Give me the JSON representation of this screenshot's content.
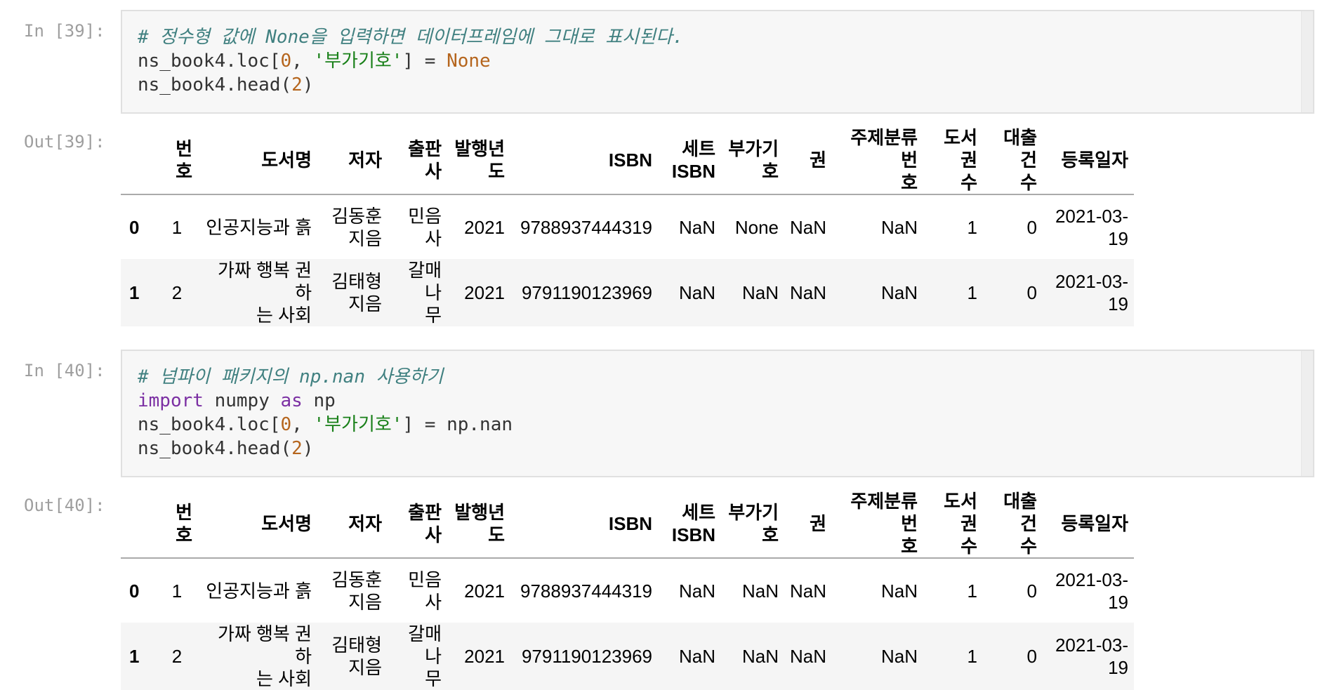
{
  "cells": [
    {
      "in_prompt": "In [39]:",
      "code_lines": [
        [
          {
            "t": "cm",
            "v": "# 정수형 값에 None을 입력하면 데이터프레임에 그대로 표시된다."
          }
        ],
        [
          {
            "t": "",
            "v": "ns_book4.loc["
          },
          {
            "t": "num",
            "v": "0"
          },
          {
            "t": "",
            "v": ", "
          },
          {
            "t": "str",
            "v": "'부가기호'"
          },
          {
            "t": "",
            "v": "] = "
          },
          {
            "t": "nn",
            "v": "None"
          }
        ],
        [
          {
            "t": "",
            "v": "ns_book4.head("
          },
          {
            "t": "num",
            "v": "2"
          },
          {
            "t": "",
            "v": ")"
          }
        ]
      ],
      "out_prompt": "Out[39]:",
      "table": {
        "headers": [
          [
            "",
            ""
          ],
          [
            "번",
            "호"
          ],
          [
            "도서명",
            ""
          ],
          [
            "저자",
            ""
          ],
          [
            "출판사",
            ""
          ],
          [
            "발행년",
            "도"
          ],
          [
            "ISBN",
            ""
          ],
          [
            "세트",
            "ISBN"
          ],
          [
            "부가기",
            "호"
          ],
          [
            "권",
            ""
          ],
          [
            "주제분류번",
            "호"
          ],
          [
            "도서권",
            "수"
          ],
          [
            "대출건",
            "수"
          ],
          [
            "등록일자",
            ""
          ]
        ],
        "rows": [
          [
            [
              "0",
              ""
            ],
            [
              "1",
              ""
            ],
            [
              "인공지능과 흙",
              ""
            ],
            [
              "김동훈",
              "지음"
            ],
            [
              "민음사",
              ""
            ],
            [
              "2021",
              ""
            ],
            [
              "9788937444319",
              ""
            ],
            [
              "NaN",
              ""
            ],
            [
              "None",
              ""
            ],
            [
              "NaN",
              ""
            ],
            [
              "NaN",
              ""
            ],
            [
              "1",
              ""
            ],
            [
              "0",
              ""
            ],
            [
              "2021-03-",
              "19"
            ]
          ],
          [
            [
              "1",
              ""
            ],
            [
              "2",
              ""
            ],
            [
              "가짜 행복 권하",
              "는 사회"
            ],
            [
              "김태형",
              "지음"
            ],
            [
              "갈매나",
              "무"
            ],
            [
              "2021",
              ""
            ],
            [
              "9791190123969",
              ""
            ],
            [
              "NaN",
              ""
            ],
            [
              "NaN",
              ""
            ],
            [
              "NaN",
              ""
            ],
            [
              "NaN",
              ""
            ],
            [
              "1",
              ""
            ],
            [
              "0",
              ""
            ],
            [
              "2021-03-",
              "19"
            ]
          ]
        ]
      }
    },
    {
      "in_prompt": "In [40]:",
      "code_lines": [
        [
          {
            "t": "cm",
            "v": "# 넘파이 패키지의 np.nan 사용하기"
          }
        ],
        [
          {
            "t": "kw",
            "v": "import"
          },
          {
            "t": "",
            "v": " numpy "
          },
          {
            "t": "kw",
            "v": "as"
          },
          {
            "t": "",
            "v": " np"
          }
        ],
        [
          {
            "t": "",
            "v": "ns_book4.loc["
          },
          {
            "t": "num",
            "v": "0"
          },
          {
            "t": "",
            "v": ", "
          },
          {
            "t": "str",
            "v": "'부가기호'"
          },
          {
            "t": "",
            "v": "] = np.nan"
          }
        ],
        [
          {
            "t": "",
            "v": "ns_book4.head("
          },
          {
            "t": "num",
            "v": "2"
          },
          {
            "t": "",
            "v": ")"
          }
        ]
      ],
      "out_prompt": "Out[40]:",
      "table": {
        "headers": [
          [
            "",
            ""
          ],
          [
            "번",
            "호"
          ],
          [
            "도서명",
            ""
          ],
          [
            "저자",
            ""
          ],
          [
            "출판사",
            ""
          ],
          [
            "발행년",
            "도"
          ],
          [
            "ISBN",
            ""
          ],
          [
            "세트",
            "ISBN"
          ],
          [
            "부가기",
            "호"
          ],
          [
            "권",
            ""
          ],
          [
            "주제분류번",
            "호"
          ],
          [
            "도서권",
            "수"
          ],
          [
            "대출건",
            "수"
          ],
          [
            "등록일자",
            ""
          ]
        ],
        "rows": [
          [
            [
              "0",
              ""
            ],
            [
              "1",
              ""
            ],
            [
              "인공지능과 흙",
              ""
            ],
            [
              "김동훈",
              "지음"
            ],
            [
              "민음사",
              ""
            ],
            [
              "2021",
              ""
            ],
            [
              "9788937444319",
              ""
            ],
            [
              "NaN",
              ""
            ],
            [
              "NaN",
              ""
            ],
            [
              "NaN",
              ""
            ],
            [
              "NaN",
              ""
            ],
            [
              "1",
              ""
            ],
            [
              "0",
              ""
            ],
            [
              "2021-03-",
              "19"
            ]
          ],
          [
            [
              "1",
              ""
            ],
            [
              "2",
              ""
            ],
            [
              "가짜 행복 권하",
              "는 사회"
            ],
            [
              "김태형",
              "지음"
            ],
            [
              "갈매나",
              "무"
            ],
            [
              "2021",
              ""
            ],
            [
              "9791190123969",
              ""
            ],
            [
              "NaN",
              ""
            ],
            [
              "NaN",
              ""
            ],
            [
              "NaN",
              ""
            ],
            [
              "NaN",
              ""
            ],
            [
              "1",
              ""
            ],
            [
              "0",
              ""
            ],
            [
              "2021-03-",
              "19"
            ]
          ]
        ]
      }
    }
  ]
}
